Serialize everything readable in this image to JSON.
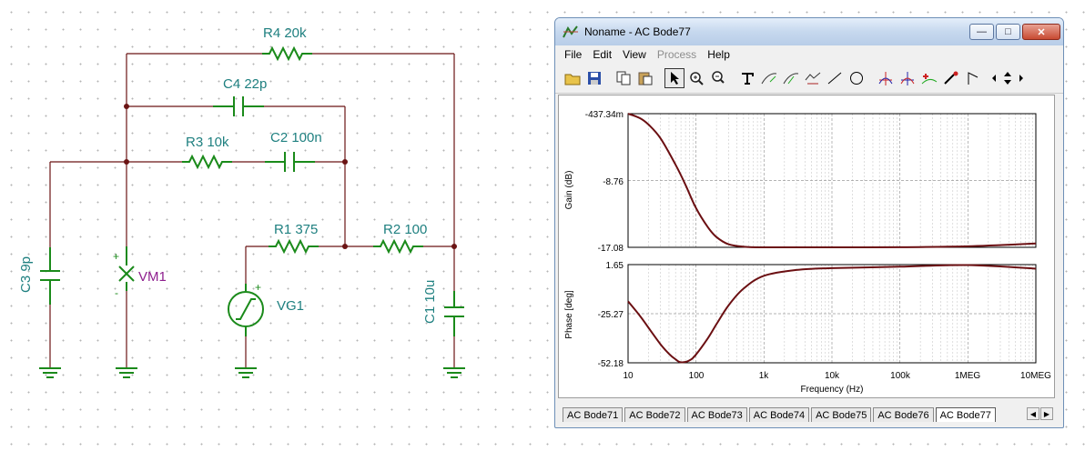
{
  "schematic": {
    "components": {
      "r4": "R4 20k",
      "c4": "C4 22p",
      "r3": "R3 10k",
      "c2": "C2 100n",
      "r1": "R1 375",
      "r2": "R2 100",
      "c3": "C3 9p",
      "c1": "C1 10u",
      "vm1": "VM1",
      "vg1": "VG1"
    },
    "polarity": {
      "plus": "+",
      "minus": "-"
    }
  },
  "window": {
    "title": "Noname - AC Bode77",
    "menu": [
      "File",
      "Edit",
      "View",
      "Process",
      "Help"
    ],
    "menu_disabled": "Process",
    "controls": {
      "minimize": "—",
      "maximize": "□",
      "close": "✕"
    }
  },
  "toolbar": {
    "icons": [
      "open-icon",
      "save-icon",
      "copy-icon",
      "paste-icon",
      "pointer-icon",
      "zoom-in-icon",
      "zoom-100-icon",
      "text-icon",
      "cursor-curve-icon",
      "cursor-curve2-icon",
      "cursor-edit-icon",
      "line-icon",
      "circle-icon",
      "cursor-a-icon",
      "cursor-b-icon",
      "data-icon",
      "probe-icon",
      "marker-icon"
    ]
  },
  "chart_data": [
    {
      "type": "line",
      "title": "",
      "ylabel": "Gain (dB)",
      "xlabel": "",
      "x_scale": "log",
      "xlim": [
        10,
        10000000
      ],
      "ylim": [
        -17.08,
        -0.43734
      ],
      "y_ticks": [
        "-437.34m",
        "-8.76",
        "-17.08"
      ],
      "color": "#6b0f12",
      "x": [
        10,
        15,
        20,
        30,
        50,
        70,
        100,
        150,
        200,
        300,
        500,
        1000,
        10000,
        100000,
        1000000,
        10000000
      ],
      "values": [
        -0.44,
        -1.0,
        -1.8,
        -3.5,
        -6.8,
        -9.3,
        -12.2,
        -14.6,
        -15.8,
        -16.7,
        -17.0,
        -17.08,
        -17.08,
        -17.07,
        -16.95,
        -16.6
      ]
    },
    {
      "type": "line",
      "title": "",
      "ylabel": "Phase [deg]",
      "xlabel": "Frequency (Hz)",
      "x_scale": "log",
      "xlim": [
        10,
        10000000
      ],
      "ylim": [
        -52.18,
        1.65
      ],
      "y_ticks": [
        "1.65",
        "-25.27",
        "-52.18"
      ],
      "x_ticks": [
        "10",
        "100",
        "1k",
        "10k",
        "100k",
        "1MEG",
        "10MEG"
      ],
      "color": "#6b0f12",
      "x": [
        10,
        15,
        20,
        30,
        40,
        50,
        60,
        80,
        100,
        150,
        200,
        300,
        500,
        1000,
        3000,
        10000,
        100000,
        1000000,
        10000000
      ],
      "values": [
        -18.5,
        -26.5,
        -33.0,
        -42.0,
        -47.3,
        -50.3,
        -51.9,
        -50.9,
        -47.6,
        -38.6,
        -31.0,
        -20.8,
        -11.5,
        -4.5,
        -1.3,
        -0.3,
        0.5,
        1.4,
        -0.6
      ]
    }
  ],
  "tabs": [
    "AC Bode71",
    "AC Bode72",
    "AC Bode73",
    "AC Bode74",
    "AC Bode75",
    "AC Bode76",
    "AC Bode77"
  ],
  "active_tab": "AC Bode77",
  "tab_nav": {
    "left": "◀",
    "right": "▶"
  }
}
